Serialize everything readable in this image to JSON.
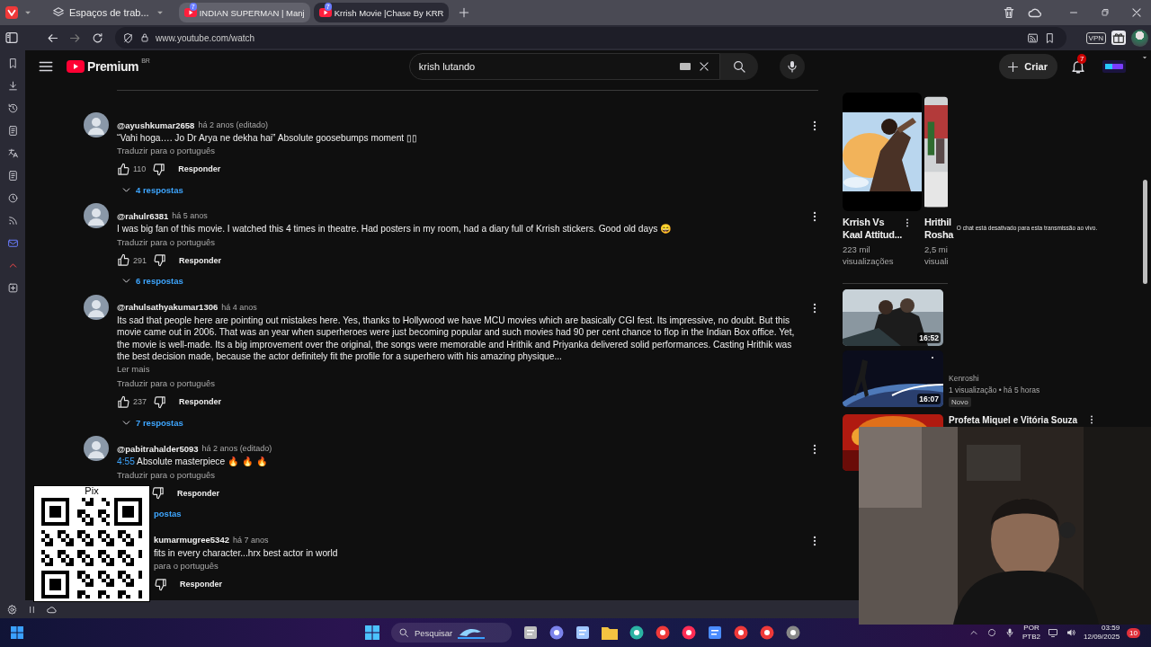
{
  "browser": {
    "workspace": "Espaços de trab...",
    "tabs": [
      {
        "label": "INDIAN SUPERMAN | Manj",
        "badge": "7",
        "selected": false
      },
      {
        "label": "Krrish Movie |Chase By KRR",
        "badge": "7",
        "selected": true
      }
    ],
    "address": "www.youtube.com/watch",
    "vpn": "VPN"
  },
  "youtube": {
    "logo": "Premium",
    "region": "BR",
    "search": "krish lutando",
    "create": "Criar",
    "notifications": "7"
  },
  "comments": [
    {
      "kind": "full",
      "author": "@ayushkumar2658",
      "age": "há 2 anos (editado)",
      "text": "“Vahi hoga…. Jo Dr Arya ne dekha hai” Absolute goosebumps moment ▯▯",
      "translate": "Traduzir para o português",
      "likes": "110",
      "reply": "Responder",
      "replies": "4 respostas"
    },
    {
      "kind": "full",
      "author": "@rahulr6381",
      "age": "há 5 anos",
      "text": "I was big fan of this movie. I watched this 4 times in theatre. Had posters in my room, had a diary full of Krrish stickers. Good old days 😄",
      "translate": "Traduzir para o português",
      "likes": "291",
      "reply": "Responder",
      "replies": "6 respostas"
    },
    {
      "kind": "full",
      "author": "@rahulsathyakumar1306",
      "age": "há 4 anos",
      "text": "Its sad that people here are pointing out mistakes here. Yes, thanks to Hollywood we have MCU movies which are basically CGI fest. Its impressive, no doubt. But this movie came out in 2006. That was an year when superheroes were just becoming popular and such movies had 90 per cent chance to flop in the Indian Box office. Yet, the movie is well-made. Its a big improvement over the original, the songs were memorable and Hrithik and Priyanka delivered solid performances. Casting Hrithik was the best decision made, because the actor definitely fit the profile for a superhero with his amazing physique...",
      "more": "Ler mais",
      "translate": "Traduzir para o português",
      "likes": "237",
      "reply": "Responder",
      "replies": "7 respostas"
    },
    {
      "kind": "lower-covered",
      "author": "@pabitrahalder5093",
      "age": "há 2 anos (editado)",
      "timestamp": "4:55",
      "text": "Absolute masterpiece 🔥 🔥 🔥",
      "translate": "Traduzir para o português",
      "reply": "Responder",
      "replies": "postas"
    },
    {
      "kind": "left-covered",
      "author": "kumarmugree5342",
      "age": "há 7 anos",
      "text": "fits in every character...hrx best actor in world",
      "translate": "para o português",
      "reply": "Responder"
    }
  ],
  "shorts": [
    {
      "title_lines": [
        "Krrish Vs",
        "Kaal Attitud..."
      ],
      "views_lines": [
        "223 mil",
        "visualizações"
      ],
      "menu": true
    },
    {
      "title_lines": [
        "Hrithil",
        "Rosha"
      ],
      "views_lines": [
        "2,5 mi",
        "visuali"
      ],
      "menu": false
    }
  ],
  "chat_notice": "O chat está desativado para esta transmissão ao vivo.",
  "videos": [
    {
      "duration": "16:52"
    },
    {
      "duration": "16:07",
      "channel": "Kenroshi",
      "meta": "1 visualização • há 5 horas",
      "badge": "Novo"
    },
    {
      "title": "Profeta Miquel e Vitória Souza"
    }
  ],
  "qr": {
    "label": "Pix"
  },
  "taskbar": {
    "search": "Pesquisar",
    "language": "POR",
    "layout": "PTB2",
    "time": "03:59",
    "date": "12/09/2025",
    "notifications": "10"
  }
}
